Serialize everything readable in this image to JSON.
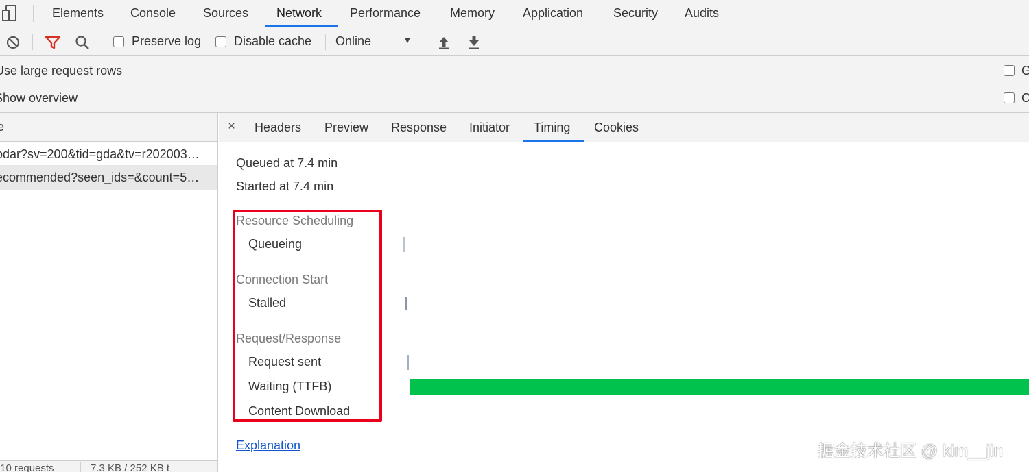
{
  "devtools": {
    "tabs": [
      {
        "label": "Elements"
      },
      {
        "label": "Console"
      },
      {
        "label": "Sources"
      },
      {
        "label": "Network"
      },
      {
        "label": "Performance"
      },
      {
        "label": "Memory"
      },
      {
        "label": "Application"
      },
      {
        "label": "Security"
      },
      {
        "label": "Audits"
      }
    ],
    "active_tab": "Network"
  },
  "toolbar": {
    "preserve_log_label": "Preserve log",
    "disable_cache_label": "Disable cache",
    "throttling_value": "Online",
    "filter_active_color": "#d93025"
  },
  "settings": {
    "large_rows_label": "Use large request rows",
    "show_overview_label": "Show overview",
    "right_col_1_label": "G",
    "right_col_2_label": "C"
  },
  "request_list": {
    "header_label": "e",
    "rows": [
      {
        "name": "odar?sv=200&tid=gda&tv=r202003…"
      },
      {
        "name": "ecommended?seen_ids=&count=5…"
      }
    ],
    "footer_requests": "/10 requests",
    "footer_size": "7.3 KB / 252 KB t"
  },
  "detail": {
    "tabs": [
      {
        "label": "Headers"
      },
      {
        "label": "Preview"
      },
      {
        "label": "Response"
      },
      {
        "label": "Initiator"
      },
      {
        "label": "Timing"
      },
      {
        "label": "Cookies"
      }
    ],
    "active_tab": "Timing",
    "close_symbol": "×"
  },
  "timing": {
    "queued_at": "Queued at 7.4 min",
    "started_at": "Started at 7.4 min",
    "sections": [
      {
        "title": "Resource Scheduling",
        "items": [
          {
            "label": "Queueing"
          }
        ]
      },
      {
        "title": "Connection Start",
        "items": [
          {
            "label": "Stalled"
          }
        ]
      },
      {
        "title": "Request/Response",
        "items": [
          {
            "label": "Request sent"
          },
          {
            "label": "Waiting (TTFB)"
          },
          {
            "label": "Content Download"
          }
        ]
      }
    ],
    "ttfb_color": "#00c24d",
    "highlight_color": "#e8001c",
    "explanation_link": "Explanation"
  },
  "watermark": "掘金技术社区 @ kim__jin"
}
